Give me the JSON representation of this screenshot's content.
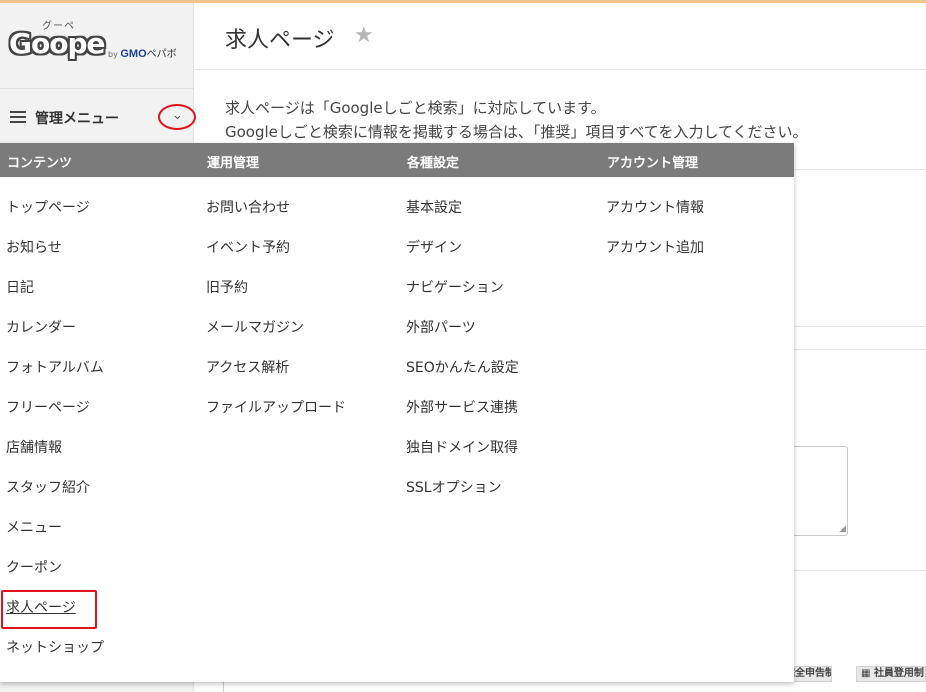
{
  "logo": {
    "wordmark": "Goope",
    "kana": "グーペ",
    "by": "by",
    "gmo": "GMO",
    "pepabo": "ペパボ"
  },
  "menu": {
    "title": "管理メニュー",
    "hamburger_icon": "hamburger-menu-icon",
    "chevron_icon": "chevron-down-icon"
  },
  "page": {
    "title": "求人ページ",
    "star_icon": "star-icon",
    "description_line1": "求人ページは「Googleしごと検索」に対応しています。",
    "description_line2": "Googleしごと検索に情報を掲載する場合は、「推奨」項目すべてを入力してください。"
  },
  "badges": {
    "left": "完全申告制",
    "right": "社員登用制"
  },
  "dropdown": {
    "columns": [
      {
        "heading": "コンテンツ",
        "items": [
          "トップページ",
          "お知らせ",
          "日記",
          "カレンダー",
          "フォトアルバム",
          "フリーページ",
          "店舗情報",
          "スタッフ紹介",
          "メニュー",
          "クーポン",
          "求人ページ",
          "ネットショップ"
        ]
      },
      {
        "heading": "運用管理",
        "items": [
          "お問い合わせ",
          "イベント予約",
          "旧予約",
          "メールマガジン",
          "アクセス解析",
          "ファイルアップロード"
        ]
      },
      {
        "heading": "各種設定",
        "items": [
          "基本設定",
          "デザイン",
          "ナビゲーション",
          "外部パーツ",
          "SEOかんたん設定",
          "外部サービス連携",
          "独自ドメイン取得",
          "SSLオプション"
        ]
      },
      {
        "heading": "アカウント管理",
        "items": [
          "アカウント情報",
          "アカウント追加"
        ]
      }
    ],
    "active_item": "求人ページ"
  },
  "colors": {
    "header_bg": "#7b7b7b",
    "highlight": "#e0131a",
    "star": "#b5b5b5"
  }
}
